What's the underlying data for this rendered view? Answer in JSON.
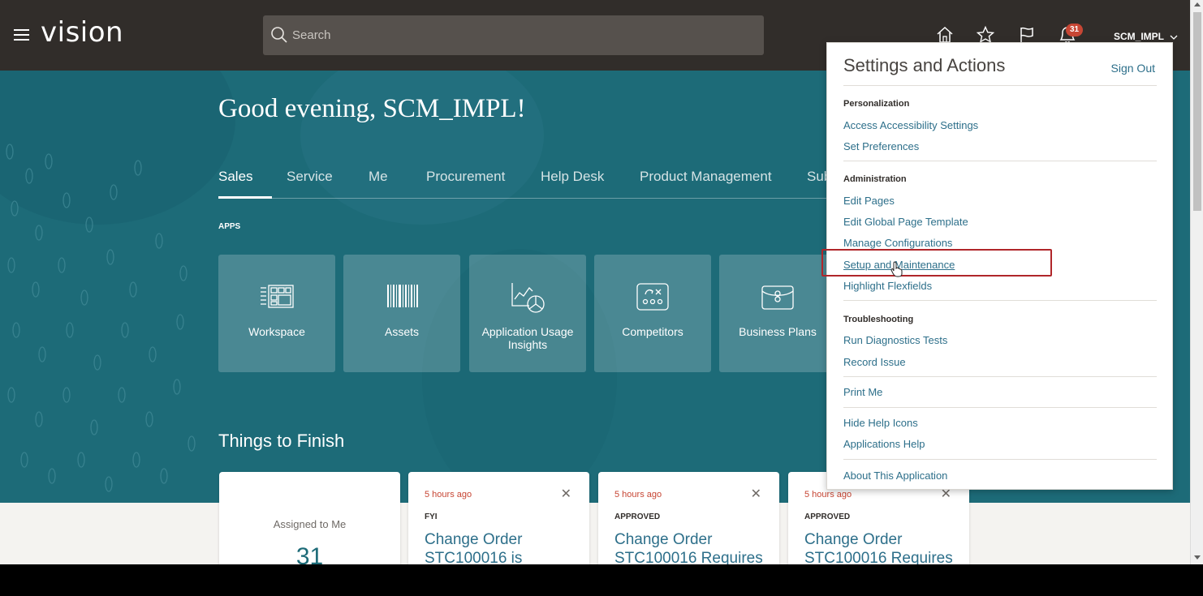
{
  "header": {
    "logo": "vision",
    "search_placeholder": "Search",
    "notification_count": "31",
    "username": "SCM_IMPL"
  },
  "banner": {
    "greeting": "Good evening, SCM_IMPL!",
    "tabs": [
      "Sales",
      "Service",
      "Me",
      "Procurement",
      "Help Desk",
      "Product Management",
      "Sub"
    ],
    "active_tab": "Sales",
    "apps_label": "APPS",
    "apps": [
      {
        "label": "Workspace",
        "icon": "workspace-icon"
      },
      {
        "label": "Assets",
        "icon": "barcode-icon"
      },
      {
        "label": "Application Usage Insights",
        "icon": "usage-insights-icon"
      },
      {
        "label": "Competitors",
        "icon": "competitors-icon"
      },
      {
        "label": "Business Plans",
        "icon": "briefcase-icon"
      }
    ],
    "things_to_finish": "Things to Finish"
  },
  "cards": {
    "assigned": {
      "label": "Assigned to Me",
      "count": "31"
    },
    "notifications": [
      {
        "time": "5 hours ago",
        "status": "FYI",
        "title": "Change Order STC100016 is"
      },
      {
        "time": "5 hours ago",
        "status": "APPROVED",
        "title": "Change Order STC100016 Requires"
      },
      {
        "time": "5 hours ago",
        "status": "APPROVED",
        "title": "Change Order STC100016 Requires"
      }
    ]
  },
  "settings_menu": {
    "title": "Settings and Actions",
    "sign_out": "Sign Out",
    "personalization": {
      "heading": "Personalization",
      "items": [
        "Access Accessibility Settings",
        "Set Preferences"
      ]
    },
    "administration": {
      "heading": "Administration",
      "items": [
        "Edit Pages",
        "Edit Global Page Template",
        "Manage Configurations",
        "Setup and Maintenance",
        "Highlight Flexfields"
      ]
    },
    "troubleshooting": {
      "heading": "Troubleshooting",
      "items": [
        "Run Diagnostics Tests",
        "Record Issue"
      ]
    },
    "print_me": "Print Me",
    "help": [
      "Hide Help Icons",
      "Applications Help"
    ],
    "about": "About This Application",
    "highlighted_item": "Setup and Maintenance"
  },
  "colors": {
    "header_bg": "#312d2a",
    "banner_bg": "#1d6b78",
    "link": "#2d6f8a",
    "accent_red": "#c74634",
    "highlight_box": "#b0262a"
  }
}
